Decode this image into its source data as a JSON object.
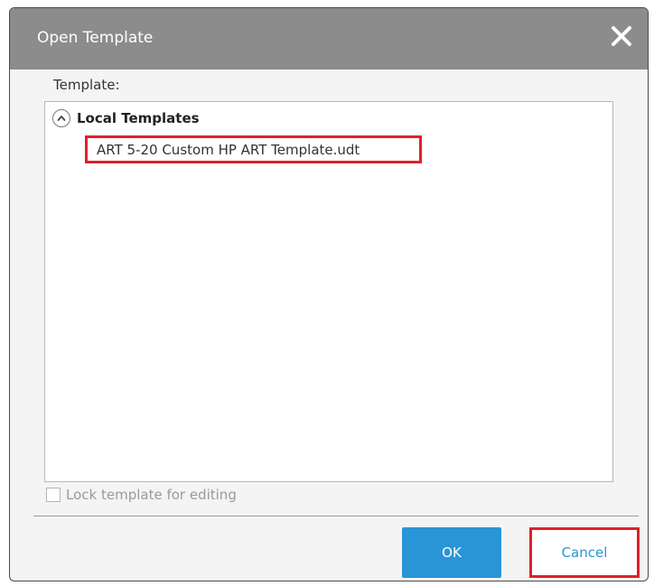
{
  "dialog": {
    "title": "Open Template",
    "close_icon": "close-icon"
  },
  "template_label": "Template:",
  "list": {
    "group": {
      "label": "Local Templates",
      "icon": "chevron-up-circle-icon"
    },
    "items": [
      {
        "label": "ART 5-20 Custom HP ART Template.udt"
      }
    ]
  },
  "lock": {
    "label": "Lock template for editing",
    "checked": false
  },
  "buttons": {
    "ok": "OK",
    "cancel": "Cancel"
  },
  "colors": {
    "titlebar": "#8c8c8c",
    "accent": "#2a95d6",
    "highlight": "#e0202a"
  }
}
